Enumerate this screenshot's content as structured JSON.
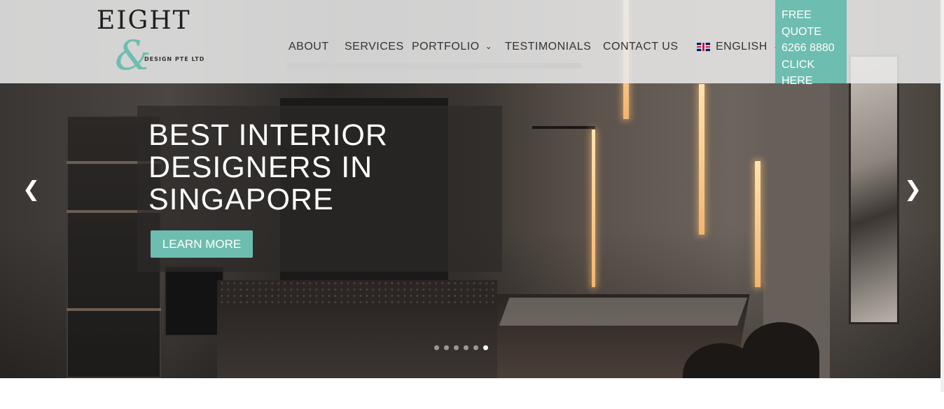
{
  "logo": {
    "wordmark": "EIGHT",
    "trademark": "™",
    "ampersand": "&",
    "tagline": "DESIGN PTE LTD"
  },
  "nav": {
    "items": [
      {
        "label": "ABOUT",
        "has_dropdown": false
      },
      {
        "label": "SERVICES",
        "has_dropdown": false
      },
      {
        "label": "PORTFOLIO",
        "has_dropdown": true
      },
      {
        "label": "TESTIMONIALS",
        "has_dropdown": false
      },
      {
        "label": "CONTACT US",
        "has_dropdown": false
      }
    ],
    "language": {
      "label": "ENGLISH",
      "icon": "uk-flag-icon"
    },
    "dropdown_icon": "chevron-down-icon"
  },
  "quote_box": {
    "line1": "FREE",
    "line2": "QUOTE",
    "line3": "6266 8880",
    "line4": "CLICK HERE"
  },
  "hero": {
    "title_line1": "BEST INTERIOR",
    "title_line2": "DESIGNERS IN",
    "title_line3": "SINGAPORE",
    "button_label": "LEARN MORE",
    "prev_icon": "chevron-left-icon",
    "next_icon": "chevron-right-icon",
    "slide_count": 6,
    "active_slide": 6
  },
  "colors": {
    "accent": "#6dbdb0",
    "header_bg": "#e8e8e8",
    "nav_text": "#333333"
  }
}
